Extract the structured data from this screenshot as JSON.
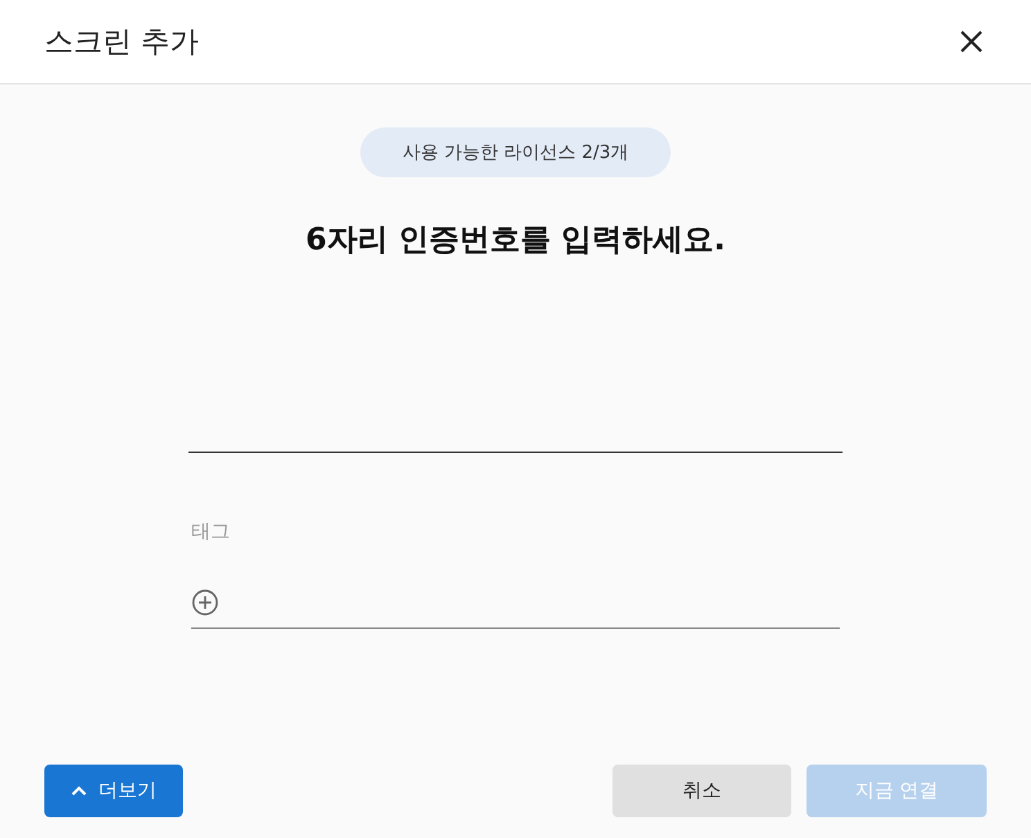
{
  "dialog": {
    "title": "스크린 추가"
  },
  "license_badge": "사용 가능한 라이선스 2/3개",
  "heading": "6자리 인증번호를 입력하세요.",
  "tag_field": {
    "label": "태그"
  },
  "buttons": [
    {
      "label": "더보기",
      "kind": "expand",
      "disabled": false
    },
    {
      "label": "취소",
      "kind": "cancel",
      "disabled": false
    },
    {
      "label": "지금 연결",
      "kind": "primary",
      "disabled": true
    }
  ]
}
